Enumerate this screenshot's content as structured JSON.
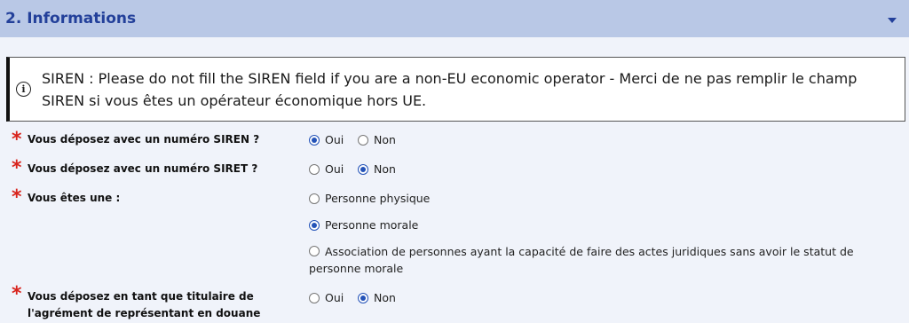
{
  "section": {
    "title": "2. Informations",
    "toggle_icon": "caret-down-icon"
  },
  "notice": {
    "icon": "info-circle-icon",
    "text": "SIREN : Please do not fill the SIREN field if you are a non-EU economic operator - Merci de ne pas remplir le champ SIREN si vous êtes un opérateur économique hors UE."
  },
  "required_marker": "*",
  "questions": [
    {
      "label": "Vous déposez avec un numéro SIREN ?",
      "options": [
        {
          "label": "Oui",
          "checked": true
        },
        {
          "label": "Non",
          "checked": false
        }
      ]
    },
    {
      "label": "Vous déposez avec un numéro SIRET ?",
      "options": [
        {
          "label": "Oui",
          "checked": false
        },
        {
          "label": "Non",
          "checked": true
        }
      ]
    },
    {
      "label": "Vous êtes une :",
      "options": [
        {
          "label": "Personne physique",
          "checked": false
        },
        {
          "label": "Personne morale",
          "checked": true
        },
        {
          "label": "Association de personnes ayant la capacité de faire des actes juridiques sans avoir le statut de personne morale",
          "checked": false
        }
      ]
    },
    {
      "label": "Vous déposez en tant que titulaire de l'agrément de représentant en douane",
      "options": [
        {
          "label": "Oui",
          "checked": false
        },
        {
          "label": "Non",
          "checked": true
        }
      ]
    }
  ],
  "colors": {
    "header_bg": "#b9c8e6",
    "header_text": "#23409a",
    "required": "#d8231c",
    "radio_checked": "#2453b8"
  }
}
